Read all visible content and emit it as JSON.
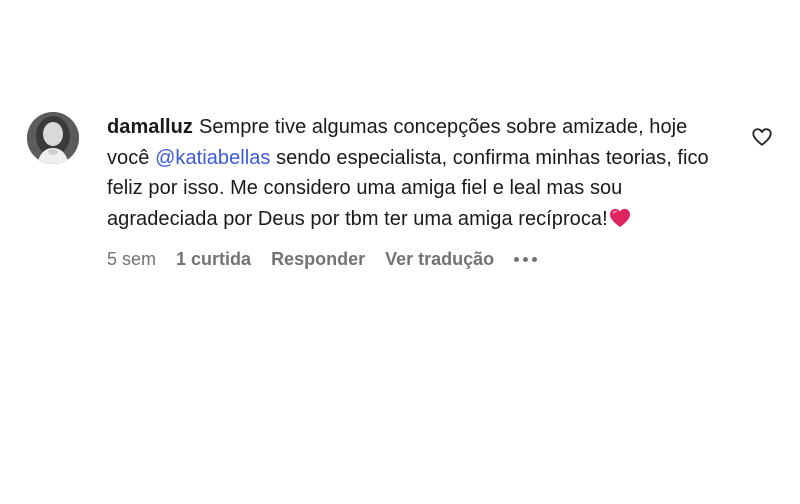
{
  "comment": {
    "username": "damalluz",
    "text_before_mention": "Sempre tive algumas concepções sobre amizade, hoje você ",
    "mention": "@katiabellas",
    "text_after_mention": " sendo especialista, confirma minhas teorias, fico feliz por isso. Me considero uma amiga fiel e leal mas sou agradeciada por Deus por tbm ter uma amiga recíproca!",
    "emoji": "heart-emoji",
    "emoji_color": "#e0245e",
    "mention_color": "#3b5bdb"
  },
  "meta": {
    "time": "5 sem",
    "likes": "1 curtida",
    "reply": "Responder",
    "translate": "Ver tradução"
  },
  "icons": {
    "like": "heart-outline-icon",
    "more": "more-options-icon"
  }
}
